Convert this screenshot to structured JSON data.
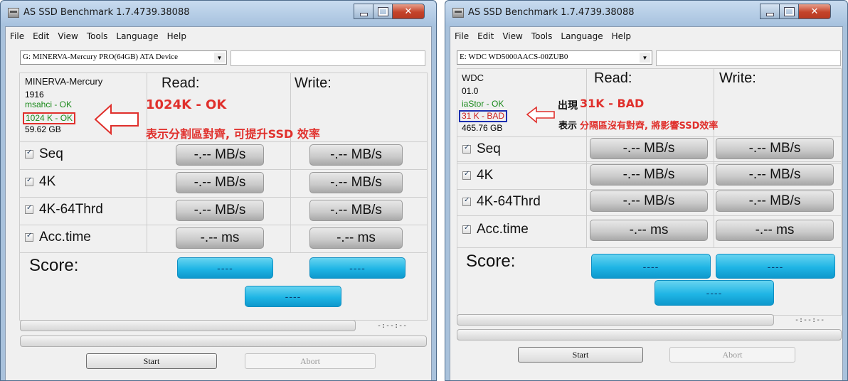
{
  "left": {
    "window_title": "AS SSD Benchmark 1.7.4739.38088",
    "menu": [
      "File",
      "Edit",
      "View",
      "Tools",
      "Language",
      "Help"
    ],
    "drive": "G: MINERVA-Mercury PRO(64GB) ATA Device",
    "device": {
      "name": "MINERVA-Mercury",
      "firmware": "1916",
      "driver": "msahci - OK",
      "alignment": "1024 K - OK",
      "size": "59.62 GB"
    },
    "read_label": "Read:",
    "write_label": "Write:",
    "rows": [
      {
        "label": "Seq",
        "read": "-.-- MB/s",
        "write": "-.-- MB/s"
      },
      {
        "label": "4K",
        "read": "-.-- MB/s",
        "write": "-.-- MB/s"
      },
      {
        "label": "4K-64Thrd",
        "read": "-.-- MB/s",
        "write": "-.-- MB/s"
      },
      {
        "label": "Acc.time",
        "read": "-.-- ms",
        "write": "-.-- ms"
      }
    ],
    "score_label": "Score:",
    "score_read": "----",
    "score_write": "----",
    "score_total": "----",
    "time": "-:--:--",
    "start": "Start",
    "abort": "Abort",
    "annotation_title": "1024K - OK",
    "annotation_text": "表示分割區對齊, 可提升SSD 效率",
    "accent_color": "#e0302c"
  },
  "right": {
    "window_title": "AS SSD Benchmark 1.7.4739.38088",
    "menu": [
      "File",
      "Edit",
      "View",
      "Tools",
      "Language",
      "Help"
    ],
    "drive": "E: WDC WD5000AACS-00ZUB0",
    "device": {
      "name": "WDC",
      "firmware": "01.0",
      "driver": "iaStor - OK",
      "alignment": "31 K - BAD",
      "size": "465.76 GB"
    },
    "read_label": "Read:",
    "write_label": "Write:",
    "rows": [
      {
        "label": "Seq",
        "read": "-.-- MB/s",
        "write": "-.-- MB/s"
      },
      {
        "label": "4K",
        "read": "-.-- MB/s",
        "write": "-.-- MB/s"
      },
      {
        "label": "4K-64Thrd",
        "read": "-.-- MB/s",
        "write": "-.-- MB/s"
      },
      {
        "label": "Acc.time",
        "read": "-.-- ms",
        "write": "-.-- ms"
      }
    ],
    "score_label": "Score:",
    "score_read": "----",
    "score_write": "----",
    "score_total": "----",
    "time": "-:--:--",
    "start": "Start",
    "abort": "Abort",
    "annotation_prefix": "出現",
    "annotation_title": "31K - BAD",
    "annotation_text_prefix": "表示",
    "annotation_text": "分隔區沒有對齊, 將影響SSD效率",
    "box_color": "#1c2fb0"
  }
}
